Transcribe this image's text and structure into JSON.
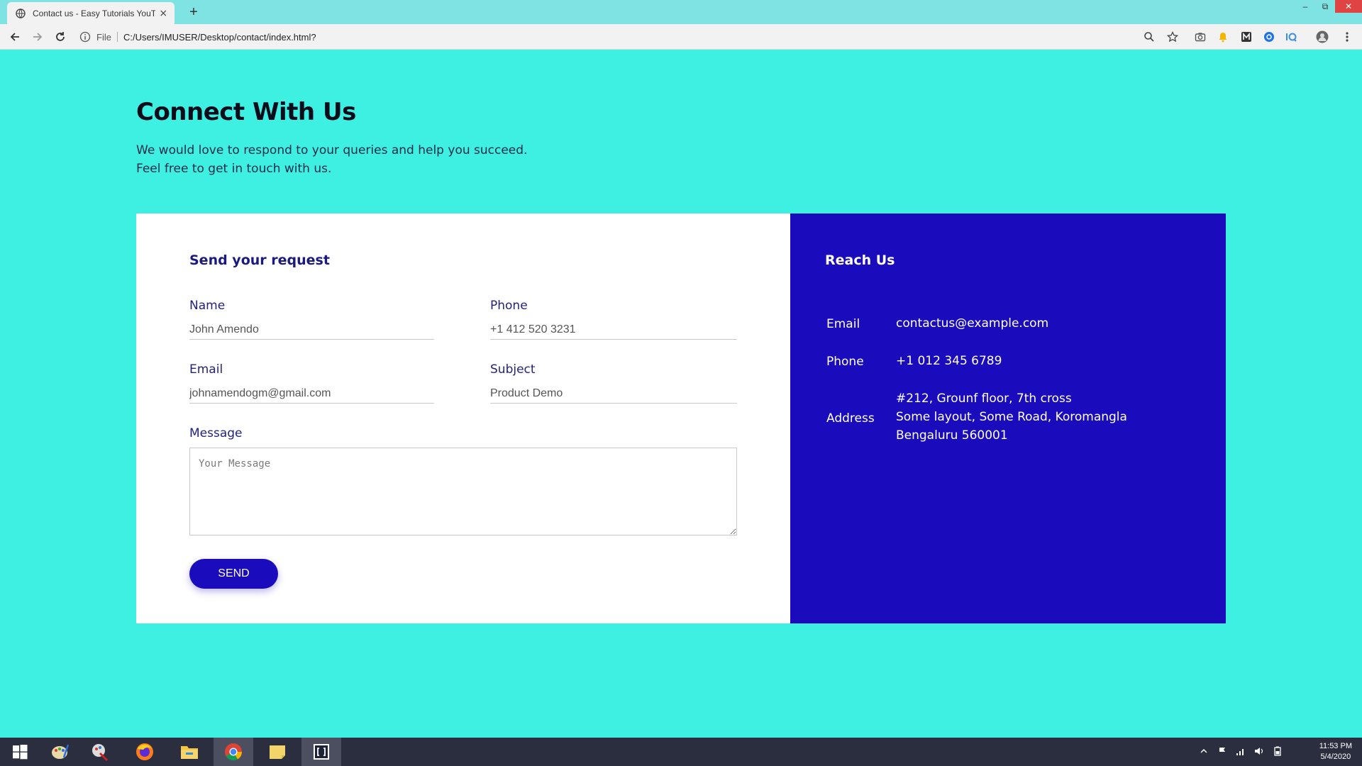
{
  "browser": {
    "tab_title": "Contact us - Easy Tutorials YouTube",
    "file_label": "File",
    "url": "C:/Users/IMUSER/Desktop/contact/index.html?",
    "new_tab": "+",
    "tab_close": "×"
  },
  "page": {
    "heading": "Connect With Us",
    "subtext_line1": "We would love to respond to your queries and help you succeed.",
    "subtext_line2": "Feel free to get in touch with us."
  },
  "form": {
    "title": "Send your request",
    "name_label": "Name",
    "name_value": "John Amendo",
    "phone_label": "Phone",
    "phone_value": "+1 412 520 3231",
    "email_label": "Email",
    "email_value": "johnamendogm@gmail.com",
    "subject_label": "Subject",
    "subject_value": "Product Demo",
    "message_label": "Message",
    "message_placeholder": "Your Message",
    "send_label": "SEND"
  },
  "reach": {
    "title": "Reach Us",
    "email_label": "Email",
    "email_value": "contactus@example.com",
    "phone_label": "Phone",
    "phone_value": "+1 012 345 6789",
    "address_label": "Address",
    "address_line1": "#212, Grounf floor, 7th cross",
    "address_line2": "Some layout, Some Road, Koromangla",
    "address_line3": "Bengaluru 560001"
  },
  "taskbar": {
    "time": "11:53 PM",
    "date": "5/4/2020"
  },
  "colors": {
    "page_background": "#3df0e2",
    "accent": "#1a0bbd",
    "form_text": "#23237a"
  }
}
